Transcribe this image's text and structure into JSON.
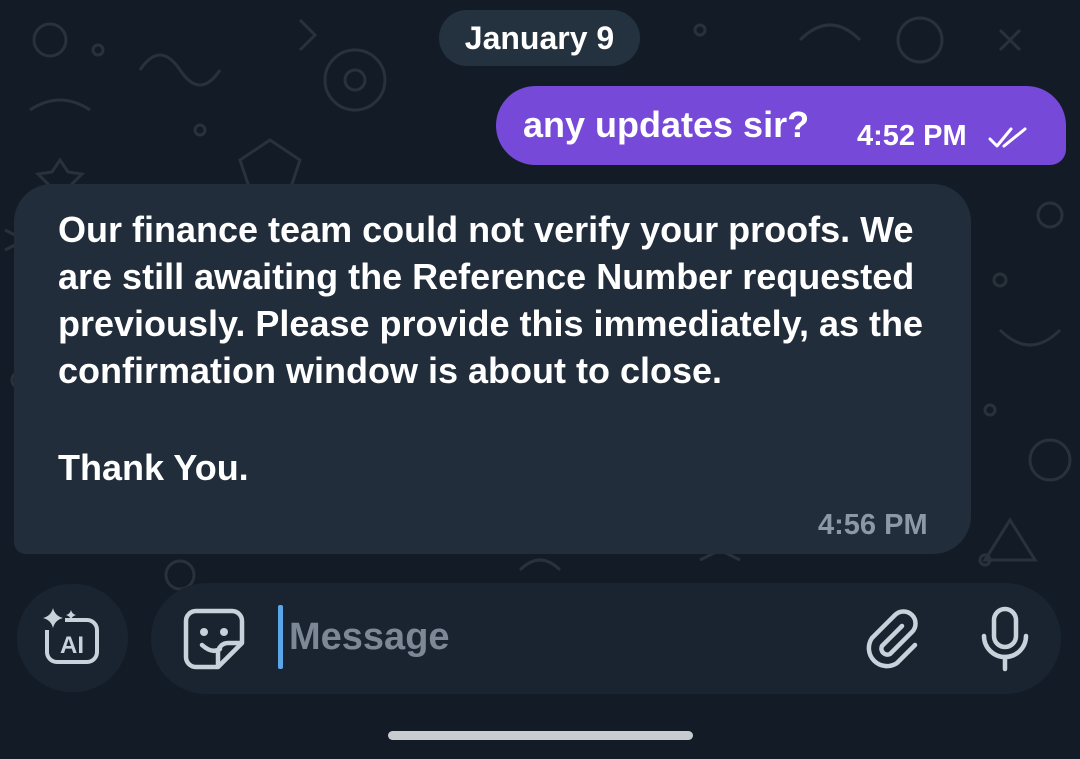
{
  "date_separator": "January 9",
  "messages": [
    {
      "direction": "outgoing",
      "text": "any updates sir?",
      "time": "4:52 PM",
      "status_icon": "double-check-icon"
    },
    {
      "direction": "incoming",
      "paragraphs": [
        "Our finance team could not verify your proofs. We are still awaiting the Reference Number requested previously. Please provide this immediately, as the confirmation window is about to close.",
        "Thank You."
      ],
      "time": "4:56 PM"
    }
  ],
  "composer": {
    "placeholder": "Message",
    "value": "",
    "ai_button_label": "AI",
    "icons": [
      "sparkle-ai-icon",
      "sticker-emoji-icon",
      "paperclip-icon",
      "microphone-icon"
    ]
  },
  "colors": {
    "background": "#131c26",
    "outgoing_bubble": "#7749d9",
    "incoming_bubble": "#212d3b",
    "date_pill": "#243240",
    "caret": "#5aa6e8",
    "muted_text": "#8a98a8"
  }
}
